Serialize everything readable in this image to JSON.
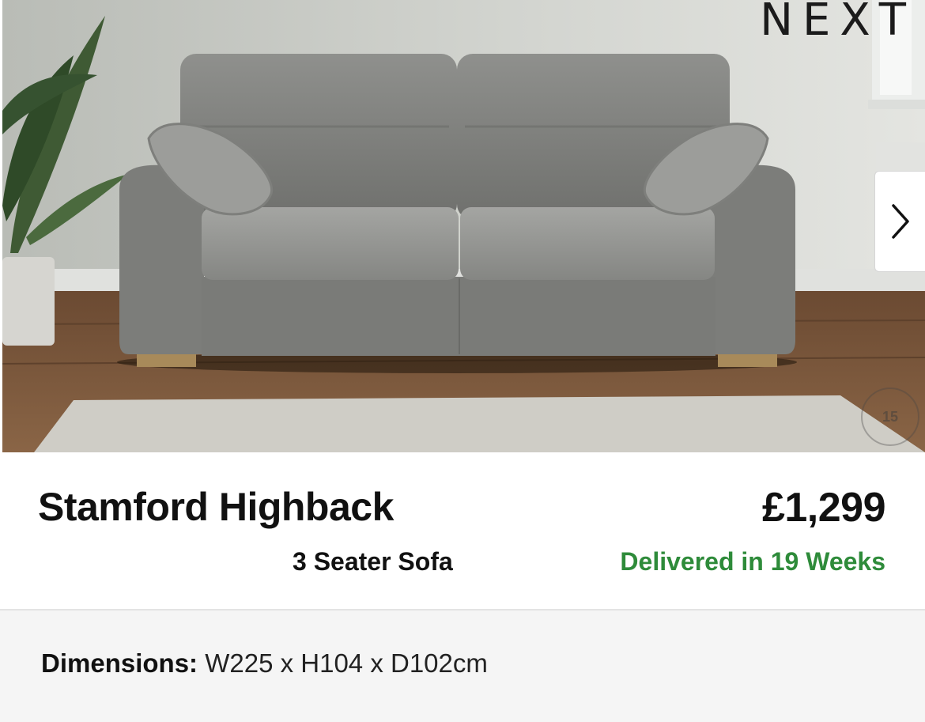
{
  "brand": {
    "logo_text": "NEXT"
  },
  "hero": {
    "image_name": "grey-sofa-photo",
    "next_icon": "chevron-right-icon",
    "badge_text": "15"
  },
  "product": {
    "name": "Stamford Highback",
    "type": "3 Seater Sofa",
    "price": "£1,299",
    "delivery": "Delivered in 19 Weeks"
  },
  "details": {
    "dimensions_label": "Dimensions:",
    "dimensions_value": "W225 x H104 x D102cm"
  },
  "colors": {
    "delivery_green": "#2e8b3a",
    "panel_bg": "#f5f5f5"
  }
}
